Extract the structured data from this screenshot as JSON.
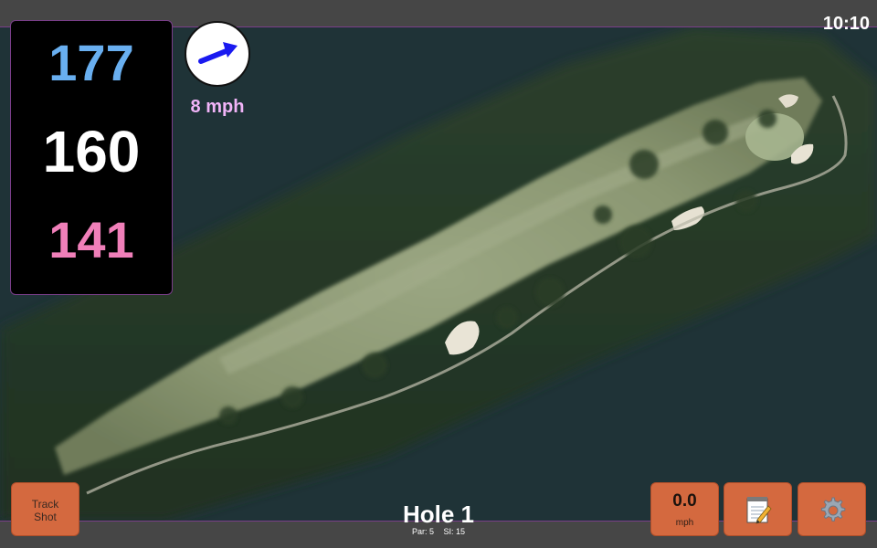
{
  "status": {
    "time": "10:10"
  },
  "distances": {
    "back": "177",
    "center": "160",
    "front": "141"
  },
  "wind": {
    "speed": "8 mph",
    "icon": "wind-direction-arrow-icon"
  },
  "hole": {
    "title": "Hole 1",
    "par": "Par: 5",
    "stroke_index": "SI: 15"
  },
  "buttons": {
    "track_shot_line1": "Track",
    "track_shot_line2": "Shot",
    "speed_value": "0.0",
    "speed_unit": "mph",
    "notes_icon": "notepad-icon",
    "settings_icon": "gear-icon"
  },
  "colors": {
    "back_distance": "#69aff0",
    "center_distance": "#ffffff",
    "front_distance": "#f07fb9",
    "wind_text": "#f1b4f8",
    "button": "#d4693f",
    "accent_border": "#7a3e8a"
  }
}
